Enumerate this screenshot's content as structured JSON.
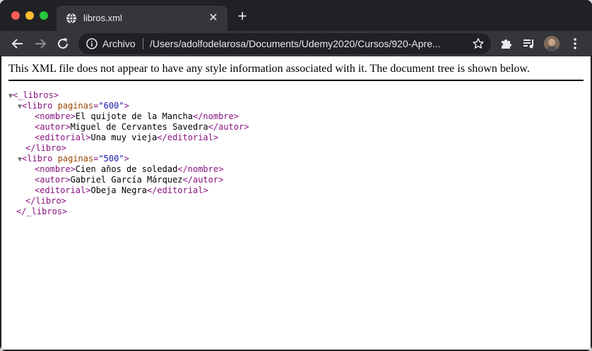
{
  "browser": {
    "tab": {
      "title": "libros.xml",
      "icon": "globe-icon",
      "close_glyph": "✕"
    },
    "new_tab_glyph": "+",
    "omnibox": {
      "scheme_label": "Archivo",
      "url": "/Users/adolfodelarosa/Documents/Udemy2020/Cursos/920-Apre..."
    },
    "toolbar_icons": [
      "back-arrow-icon",
      "forward-arrow-icon",
      "reload-icon",
      "info-icon",
      "star-icon",
      "extensions-puzzle-icon",
      "media-queue-icon",
      "profile-avatar",
      "more-vertical-icon"
    ]
  },
  "page": {
    "xml_notice": "This XML file does not appear to have any style information associated with it. The document tree is shown below."
  },
  "xml_tree": {
    "triangle_glyph": "▼",
    "root_open": "<_libros>",
    "root_close": "</_libros>",
    "libros": [
      {
        "open_tag": "<libro",
        "attr_name": "paginas",
        "attr_eq": "=",
        "attr_value": "\"600\"",
        "attr_end": ">",
        "close_tag": "</libro>",
        "children": [
          {
            "open": "<nombre>",
            "text": "El quijote de la Mancha",
            "close": "</nombre>"
          },
          {
            "open": "<autor>",
            "text": "Miguel de Cervantes Savedra",
            "close": "</autor>"
          },
          {
            "open": "<editorial>",
            "text": "Una muy vieja",
            "close": "</editorial>"
          }
        ]
      },
      {
        "open_tag": "<libro",
        "attr_name": "paginas",
        "attr_eq": "=",
        "attr_value": "\"500\"",
        "attr_end": ">",
        "close_tag": "</libro>",
        "children": [
          {
            "open": "<nombre>",
            "text": "Cien años de soledad",
            "close": "</nombre>"
          },
          {
            "open": "<autor>",
            "text": "Gabriel García Márquez",
            "close": "</autor>"
          },
          {
            "open": "<editorial>",
            "text": "Obeja Negra",
            "close": "</editorial>"
          }
        ]
      }
    ]
  },
  "colors": {
    "tag": "#881280",
    "attribute_name": "#994500",
    "attribute_value": "#1a1aa6",
    "window_frame": "#202124",
    "toolbar": "#35363a"
  }
}
